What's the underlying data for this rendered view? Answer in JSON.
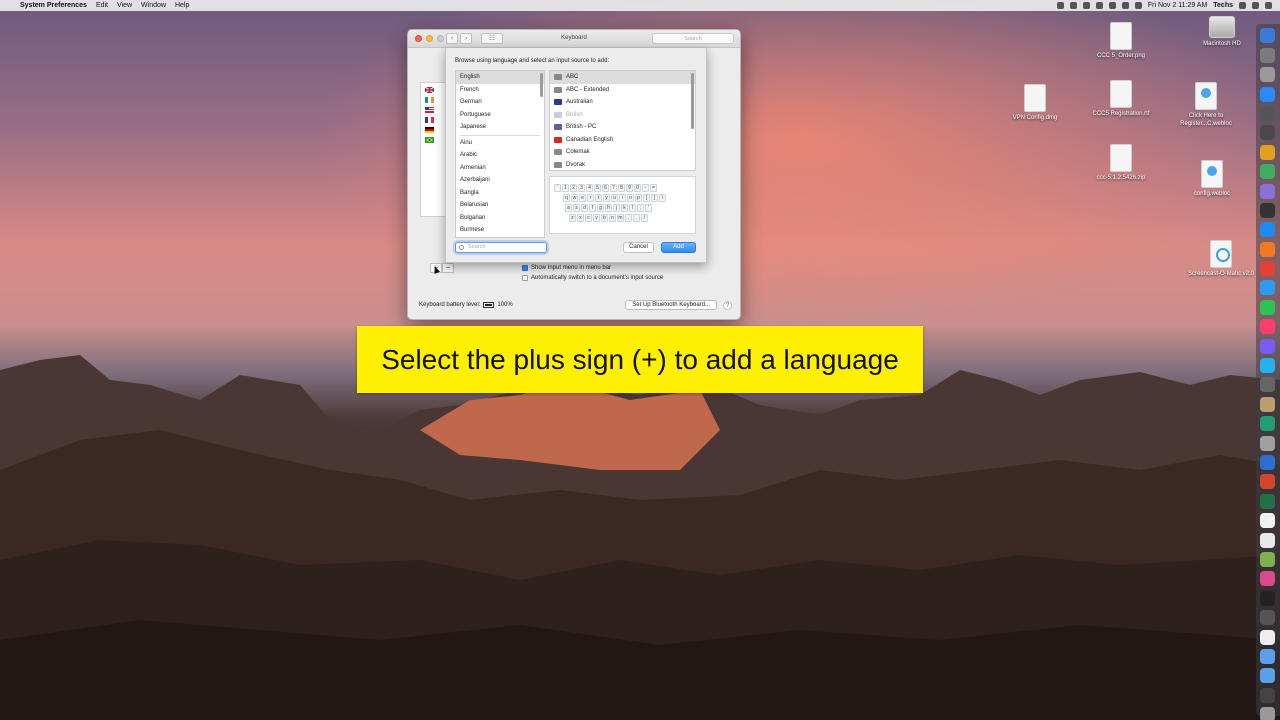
{
  "menubar": {
    "app_name": "System Preferences",
    "menus": [
      "Edit",
      "View",
      "Window",
      "Help"
    ],
    "datetime": "Fri Nov 2  11:29 AM",
    "user": "Techs"
  },
  "window": {
    "title": "Keyboard",
    "search_placeholder": "Search",
    "show_input_menu_label": "Show Input menu in menu bar",
    "auto_switch_label": "Automatically switch to a document's input source",
    "battery_label": "Keyboard battery level:",
    "battery_value": "100%",
    "bluetooth_button": "Set Up Bluetooth Keyboard...",
    "help_label": "?"
  },
  "sheet": {
    "prompt": "Browse using language and select an input source to add:",
    "languages_top": [
      "English",
      "French",
      "German",
      "Portuguese",
      "Japanese"
    ],
    "languages_all": [
      "Ainu",
      "Arabic",
      "Armenian",
      "Azerbaijani",
      "Bangla",
      "Belarusian",
      "Bulgarian",
      "Burmese"
    ],
    "sources": [
      {
        "label": "ABC",
        "state": "selected",
        "icon": "abc-icon"
      },
      {
        "label": "ABC - Extended",
        "state": "normal",
        "icon": "abc-icon"
      },
      {
        "label": "Australian",
        "state": "normal",
        "icon": "australia-flag-icon"
      },
      {
        "label": "British",
        "state": "disabled",
        "icon": "uk-flag-icon"
      },
      {
        "label": "British - PC",
        "state": "normal",
        "icon": "uk-flag-icon"
      },
      {
        "label": "Canadian English",
        "state": "normal",
        "icon": "canada-flag-icon"
      },
      {
        "label": "Colemak",
        "state": "normal",
        "icon": "co-icon"
      },
      {
        "label": "Dvorak",
        "state": "normal",
        "icon": "dv-icon"
      }
    ],
    "keyboard_rows": [
      [
        "`",
        "1",
        "2",
        "3",
        "4",
        "5",
        "6",
        "7",
        "8",
        "9",
        "0",
        "-",
        "="
      ],
      [
        "q",
        "w",
        "e",
        "r",
        "t",
        "y",
        "u",
        "i",
        "o",
        "p",
        "[",
        "]",
        "\\"
      ],
      [
        "a",
        "s",
        "d",
        "f",
        "g",
        "h",
        "j",
        "k",
        "l",
        ";",
        "'"
      ],
      [
        "z",
        "x",
        "c",
        "v",
        "b",
        "n",
        "m",
        ",",
        ".",
        "/"
      ]
    ],
    "search_placeholder": "Search",
    "cancel_label": "Cancel",
    "add_label": "Add"
  },
  "caption": "Select the plus sign (+) to add a language",
  "desktop_icons": [
    {
      "label": "CCC 5_Order.png",
      "kind": "file"
    },
    {
      "label": "Macintosh HD",
      "kind": "disk"
    },
    {
      "label": "VPN Config.dmg",
      "kind": "file"
    },
    {
      "label": "CCC5 Registration.rtf",
      "kind": "file"
    },
    {
      "label": "Click Here to Register...C.webloc",
      "kind": "web"
    },
    {
      "label": "ccc-5.1.2.5426.zip",
      "kind": "file"
    },
    {
      "label": "config.webloc",
      "kind": "web"
    },
    {
      "label": "Screencast-O-Matic v2.0",
      "kind": "app"
    }
  ],
  "dock_colors": [
    "#3d7ad6",
    "#7b7b7b",
    "#9a9a9a",
    "#2a8af6",
    "#555",
    "#4a4a4a",
    "#e0a020",
    "#3cae5e",
    "#8e6fd8",
    "#333",
    "#1d8cf0",
    "#f07a20",
    "#e34133",
    "#2f9af0",
    "#2ec254",
    "#fc3d6d",
    "#7a5cf0",
    "#26b0f0",
    "#666",
    "#b9a06c",
    "#1f9f72",
    "#a0a0a0",
    "#2b6fd3",
    "#d2472b",
    "#207245",
    "#f2f2f2",
    "#e9e9e9",
    "#7fb04c",
    "#d94a8a",
    "#222",
    "#555",
    "#eee",
    "#5ba0e8",
    "#5ba0e8",
    "#444",
    "#999"
  ],
  "colors": {
    "caption_bg": "#ffef00",
    "accent": "#2d8bf3"
  }
}
